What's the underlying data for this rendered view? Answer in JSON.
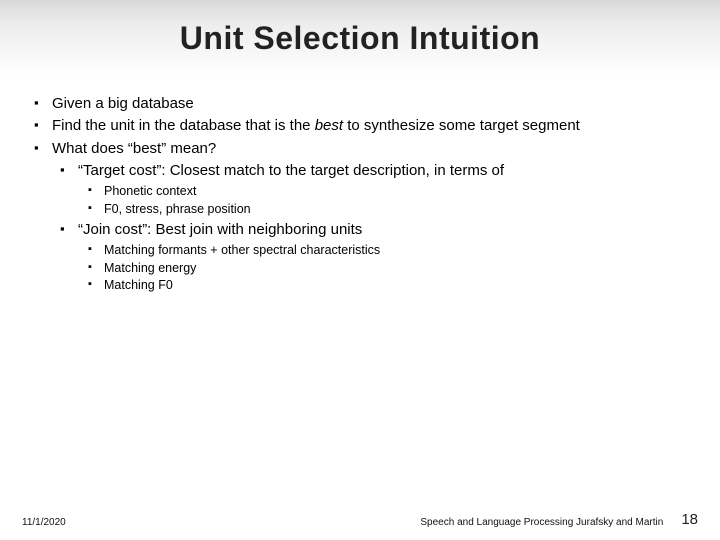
{
  "title": "Unit Selection Intuition",
  "bullets": {
    "b1": "Given a big database",
    "b2_pre": "Find the unit in the database that is the ",
    "b2_em": "best",
    "b2_post": " to synthesize some target segment",
    "b3": "What does “best” mean?",
    "b3a": "“Target cost”: Closest match to the target description, in terms of",
    "b3a1": "Phonetic context",
    "b3a2": "F0, stress, phrase position",
    "b3b": "“Join cost”: Best join with neighboring units",
    "b3b1": "Matching formants + other spectral characteristics",
    "b3b2": "Matching energy",
    "b3b3": "Matching F0"
  },
  "footer": {
    "date": "11/1/2020",
    "credit": "Speech and Language Processing  Jurafsky and Martin",
    "page": "18"
  }
}
